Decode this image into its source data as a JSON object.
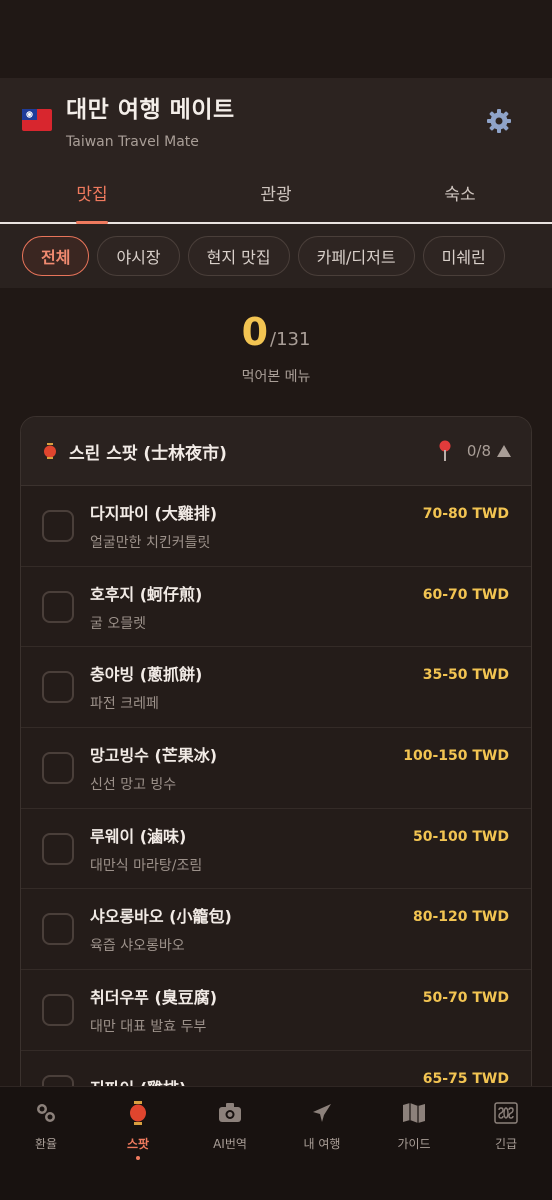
{
  "header": {
    "title": "대만 여행 메이트",
    "subtitle": "Taiwan Travel Mate",
    "flag_icon": "taiwan-flag-icon",
    "settings_icon": "gear-icon"
  },
  "tabs": [
    {
      "label": "맛집",
      "active": true
    },
    {
      "label": "관광",
      "active": false
    },
    {
      "label": "숙소",
      "active": false
    }
  ],
  "filters": [
    {
      "label": "전체",
      "active": true
    },
    {
      "label": "야시장",
      "active": false
    },
    {
      "label": "현지 맛집",
      "active": false
    },
    {
      "label": "카페/디저트",
      "active": false
    },
    {
      "label": "미쉐린",
      "active": false
    }
  ],
  "counter": {
    "eaten": "0",
    "total": "/131",
    "label": "먹어본 메뉴"
  },
  "section": {
    "title": "스린 스팟 (士林夜市)",
    "count": "0/8",
    "expanded": true,
    "items": [
      {
        "name": "다지파이 (大雞排)",
        "desc": "얼굴만한 치킨커틀릿",
        "price": "70-80 TWD"
      },
      {
        "name": "호후지 (蚵仔煎)",
        "desc": "굴 오믈렛",
        "price": "60-70 TWD"
      },
      {
        "name": "충야빙 (蔥抓餅)",
        "desc": "파전 크레페",
        "price": "35-50 TWD"
      },
      {
        "name": "망고빙수 (芒果冰)",
        "desc": "신선 망고 빙수",
        "price": "100-150 TWD"
      },
      {
        "name": "루웨이 (滷味)",
        "desc": "대만식 마라탕/조림",
        "price": "50-100 TWD"
      },
      {
        "name": "샤오롱바오 (小籠包)",
        "desc": "육즙 샤오롱바오",
        "price": "80-120 TWD"
      },
      {
        "name": "취더우푸 (臭豆腐)",
        "desc": "대만 대표 발효 두부",
        "price": "50-70 TWD"
      },
      {
        "name": "지파이 (雞排)",
        "desc": "",
        "price": "65-75 TWD"
      }
    ]
  },
  "nav": [
    {
      "label": "환율",
      "icon": "exchange-icon",
      "active": false
    },
    {
      "label": "스팟",
      "icon": "lantern-icon",
      "active": true
    },
    {
      "label": "AI번역",
      "icon": "camera-icon",
      "active": false
    },
    {
      "label": "내 여행",
      "icon": "airplane-icon",
      "active": false
    },
    {
      "label": "가이드",
      "icon": "map-icon",
      "active": false
    },
    {
      "label": "긴급",
      "icon": "sos-icon",
      "active": false
    }
  ]
}
